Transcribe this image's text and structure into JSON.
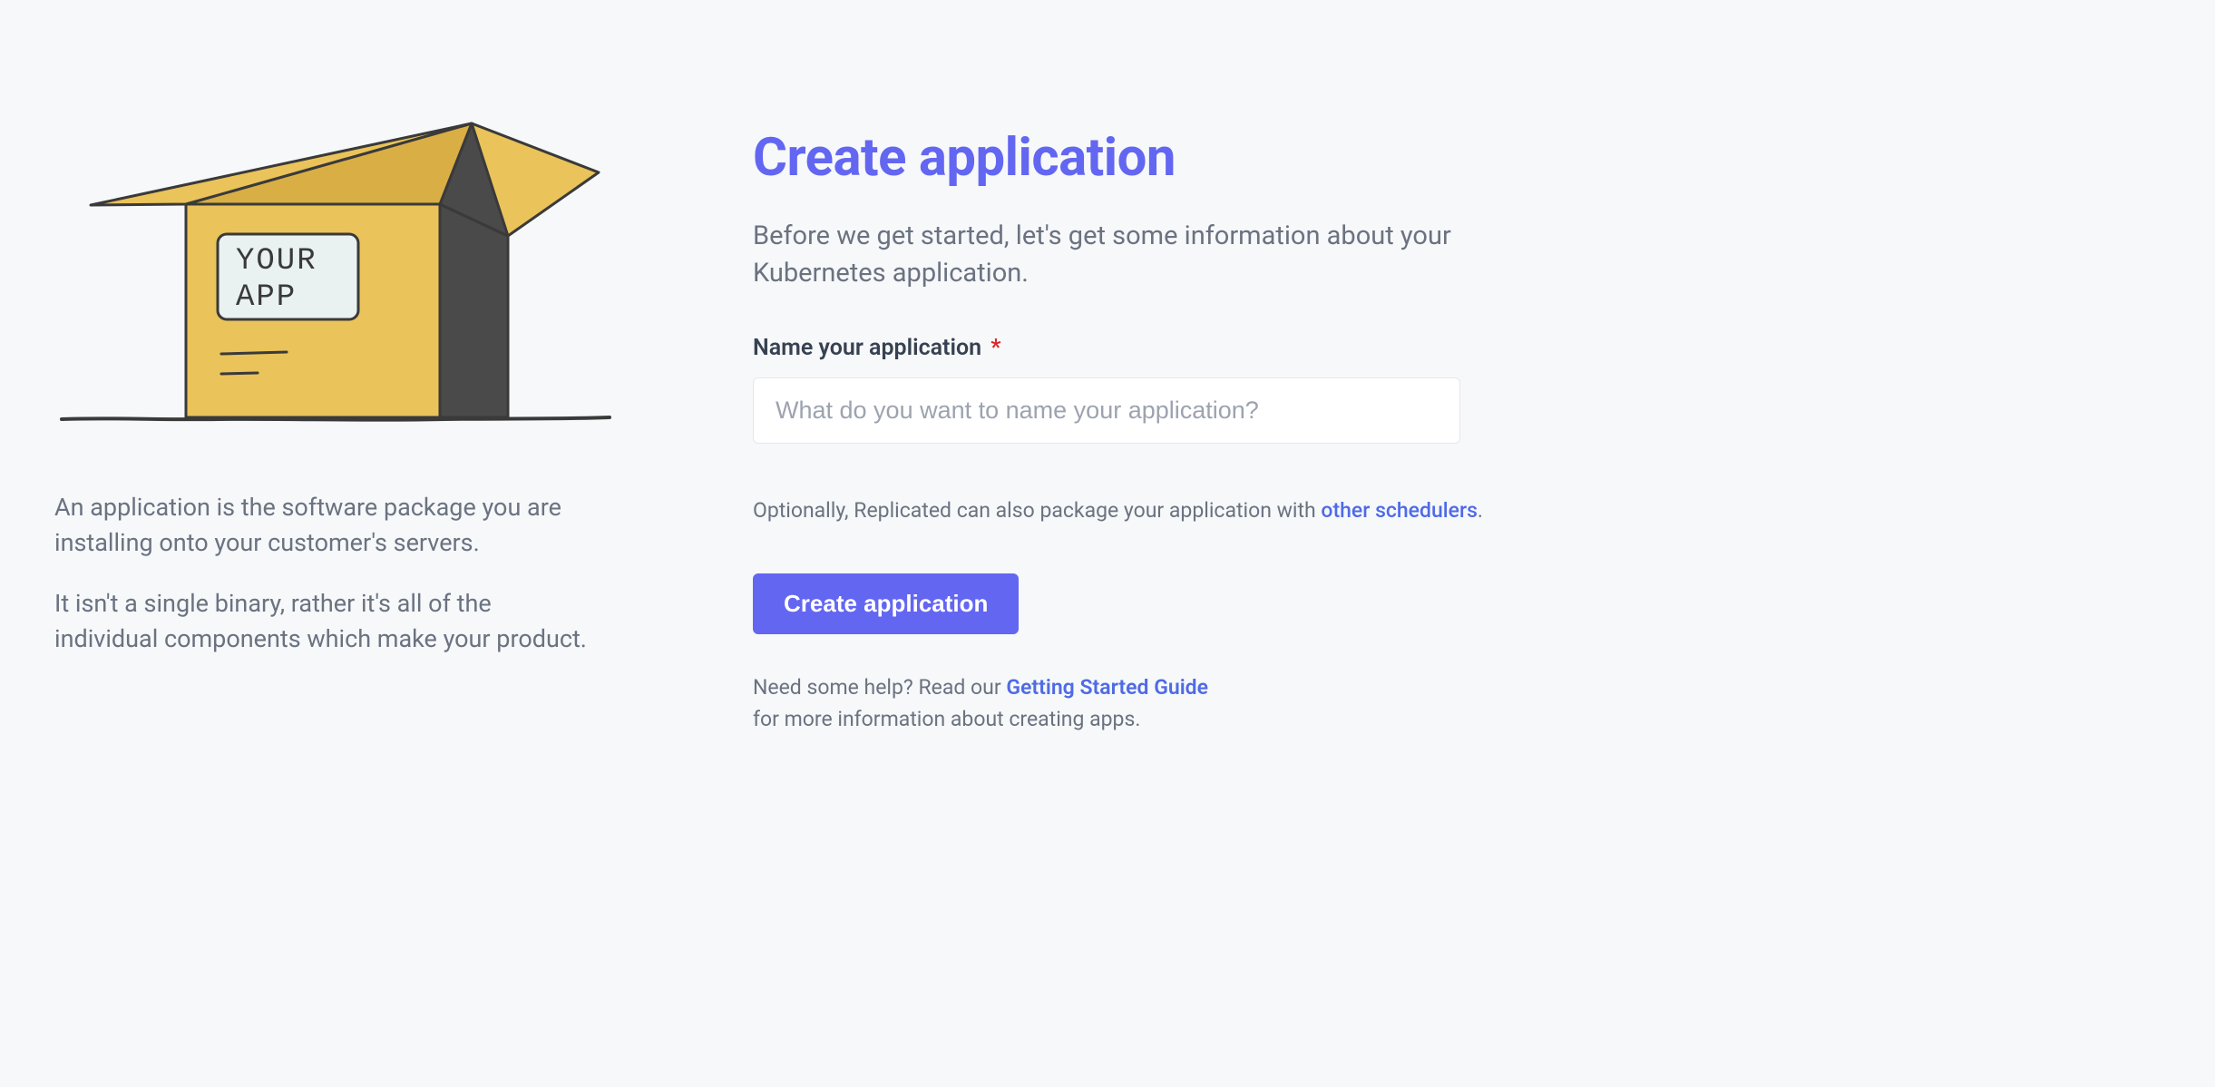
{
  "left": {
    "box_label_line1": "YOUR",
    "box_label_line2": "APP",
    "para1": "An application is the software package you are installing onto your customer's servers.",
    "para2": "It isn't a single binary, rather it's all of the individual components which make your product."
  },
  "right": {
    "heading": "Create application",
    "lead": "Before we get started, let's get some information about your Kubernetes application.",
    "name_label": "Name your application",
    "name_required_mark": "*",
    "name_placeholder": "What do you want to name your application?",
    "optional_prefix": "Optionally, Replicated can also package your application with ",
    "optional_link": "other schedulers",
    "optional_suffix": ".",
    "create_button": "Create application",
    "help_prefix": "Need some help? Read our ",
    "help_link": "Getting Started Guide",
    "help_suffix": " for more information about creating apps."
  }
}
